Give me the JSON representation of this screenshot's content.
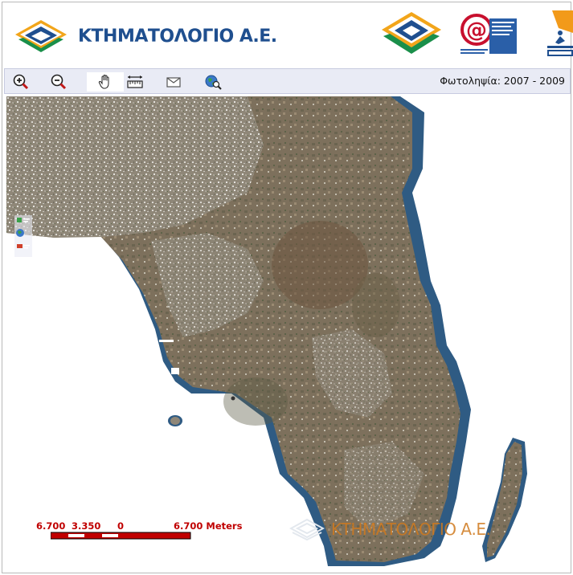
{
  "header": {
    "brand_name": "ΚΤΗΜΑΤΟΛΟΓΙΟ Α.Ε.",
    "logos": [
      "ktimatologio-logo",
      "information-society-logo",
      "greece-2006-logo"
    ]
  },
  "toolbar": {
    "tools": [
      {
        "name": "zoom-in-icon"
      },
      {
        "name": "zoom-out-icon"
      },
      {
        "name": "pan-hand-icon"
      },
      {
        "name": "measure-icon"
      },
      {
        "name": "envelope-icon"
      },
      {
        "name": "globe-search-icon"
      }
    ],
    "photo_label": "Φωτοληψία: 2007 - 2009"
  },
  "map": {
    "scale": {
      "left": "6.700",
      "mid": "3.350",
      "zero": "0",
      "right": "6.700 Meters"
    },
    "watermark": "ΚΤΗΜΑΤΟΛΟΓΙΟ Α.Ε.",
    "colors": {
      "scale_text": "#c00000",
      "watermark": "#d07a1e",
      "sea_shallow": "#2e5a8a"
    }
  }
}
